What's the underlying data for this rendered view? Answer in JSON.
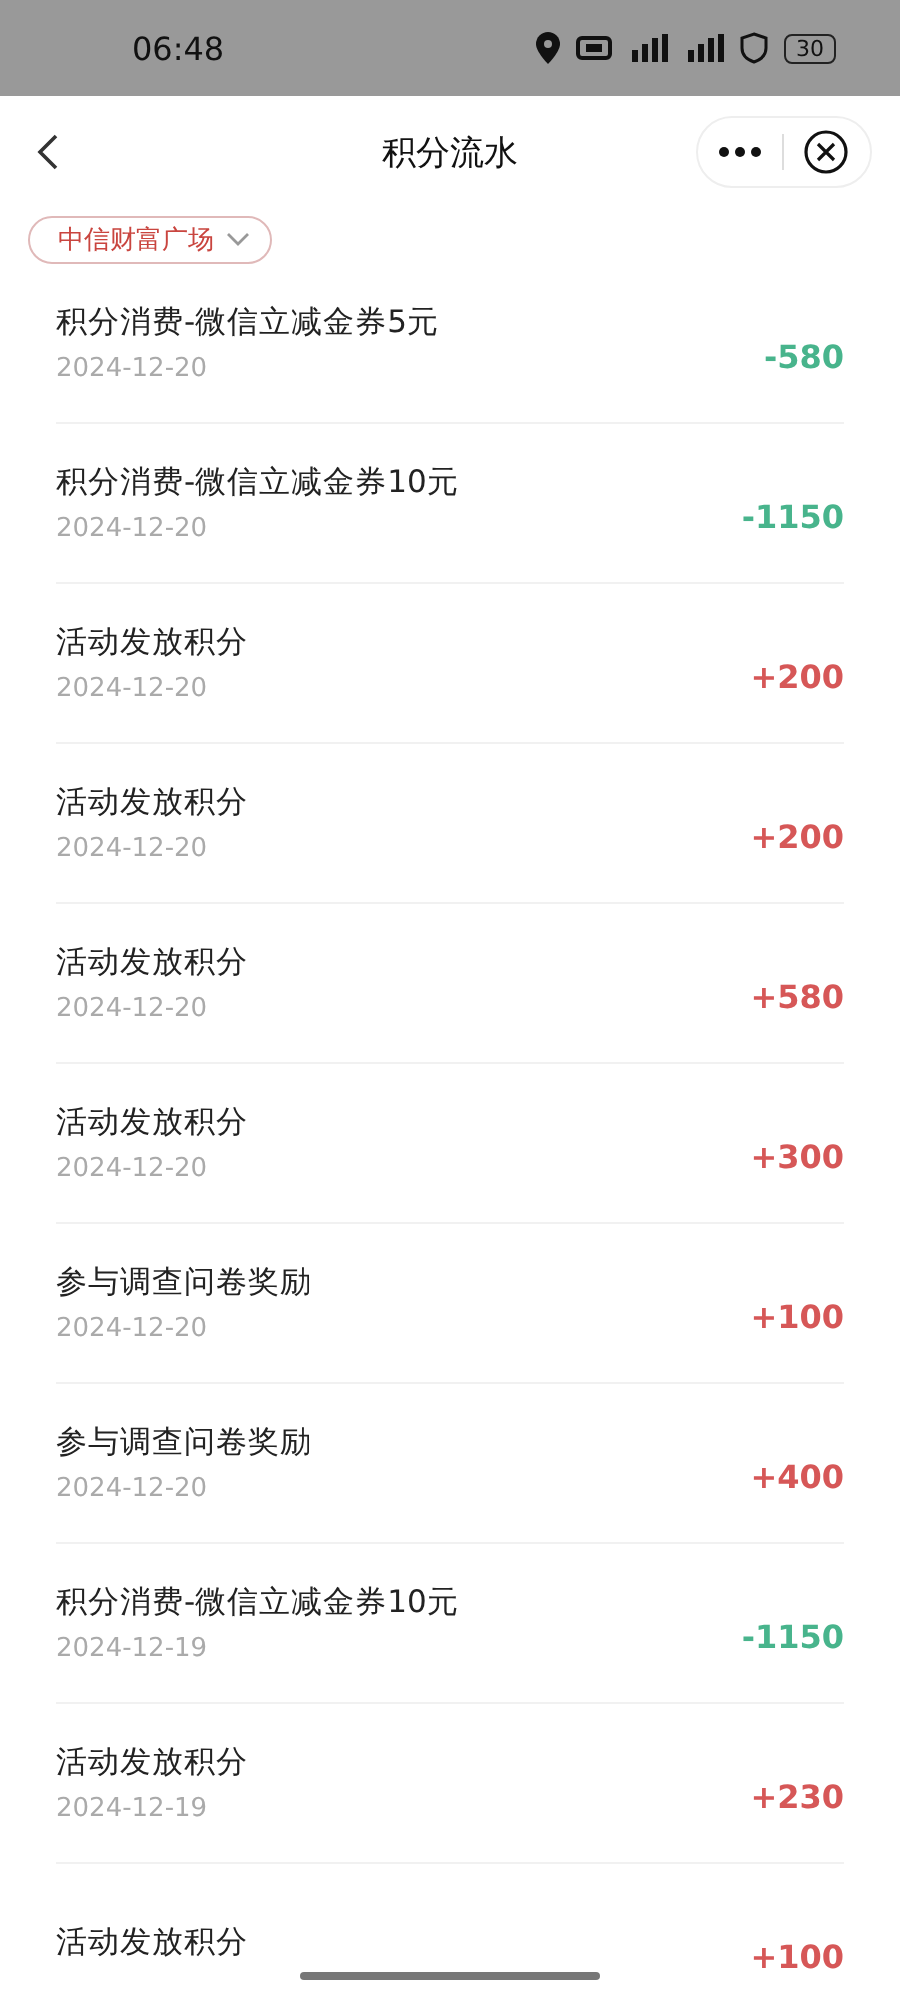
{
  "status_bar": {
    "time": "06:48",
    "battery": "30"
  },
  "nav": {
    "title": "积分流水"
  },
  "store_filter": {
    "label": "中信财富广场"
  },
  "records": [
    {
      "title": "积分消费-微信立减金券5元",
      "date": "2024-12-20",
      "amount": "-580",
      "kind": "spend"
    },
    {
      "title": "积分消费-微信立减金券10元",
      "date": "2024-12-20",
      "amount": "-1150",
      "kind": "spend"
    },
    {
      "title": "活动发放积分",
      "date": "2024-12-20",
      "amount": "+200",
      "kind": "earn"
    },
    {
      "title": "活动发放积分",
      "date": "2024-12-20",
      "amount": "+200",
      "kind": "earn"
    },
    {
      "title": "活动发放积分",
      "date": "2024-12-20",
      "amount": "+580",
      "kind": "earn"
    },
    {
      "title": "活动发放积分",
      "date": "2024-12-20",
      "amount": "+300",
      "kind": "earn"
    },
    {
      "title": "参与调查问卷奖励",
      "date": "2024-12-20",
      "amount": "+100",
      "kind": "earn"
    },
    {
      "title": "参与调查问卷奖励",
      "date": "2024-12-20",
      "amount": "+400",
      "kind": "earn"
    },
    {
      "title": "积分消费-微信立减金券10元",
      "date": "2024-12-19",
      "amount": "-1150",
      "kind": "spend"
    },
    {
      "title": "活动发放积分",
      "date": "2024-12-19",
      "amount": "+230",
      "kind": "earn"
    },
    {
      "title": "活动发放积分",
      "amount": "+100",
      "kind": "earn"
    }
  ]
}
